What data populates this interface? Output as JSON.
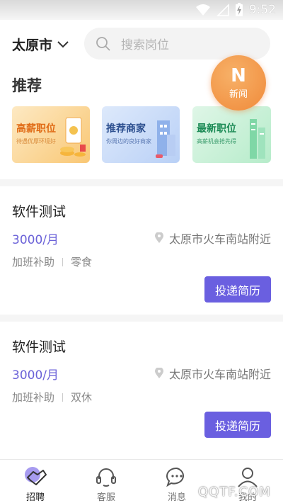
{
  "status_bar": {
    "time": "9:52"
  },
  "header": {
    "city": "太原市",
    "search_placeholder": "搜索岗位"
  },
  "recommend": {
    "title": "推荐",
    "news_badge": {
      "logo": "N",
      "label": "新闻"
    },
    "cards": [
      {
        "title": "高薪职位",
        "subtitle": "待遇优厚环境好"
      },
      {
        "title": "推荐商家",
        "subtitle": "你周边的良好商家"
      },
      {
        "title": "最新职位",
        "subtitle": "高薪机会抢先得"
      }
    ]
  },
  "jobs": [
    {
      "title": "软件测试",
      "salary": "3000/月",
      "location": "太原市火车南站附近",
      "tags": [
        "加班补助",
        "零食"
      ],
      "apply_label": "投递简历"
    },
    {
      "title": "软件测试",
      "salary": "3000/月",
      "location": "太原市火车南站附近",
      "tags": [
        "加班补助",
        "双休"
      ],
      "apply_label": "投递简历"
    }
  ],
  "tabbar": {
    "items": [
      {
        "label": "招聘",
        "active": true
      },
      {
        "label": "客服",
        "active": false
      },
      {
        "label": "消息",
        "active": false
      },
      {
        "label": "我的",
        "active": false
      }
    ]
  },
  "watermark": "QQTF.COM",
  "colors": {
    "accent": "#6a5fe0",
    "salary": "#6b62d8",
    "news_badge": "#f08a3a"
  },
  "icons": [
    "wifi-icon",
    "signal-icon",
    "battery-icon",
    "chevron-down-icon",
    "search-icon",
    "location-pin-icon",
    "handshake-icon",
    "headset-icon",
    "chat-bubble-icon",
    "user-icon"
  ]
}
